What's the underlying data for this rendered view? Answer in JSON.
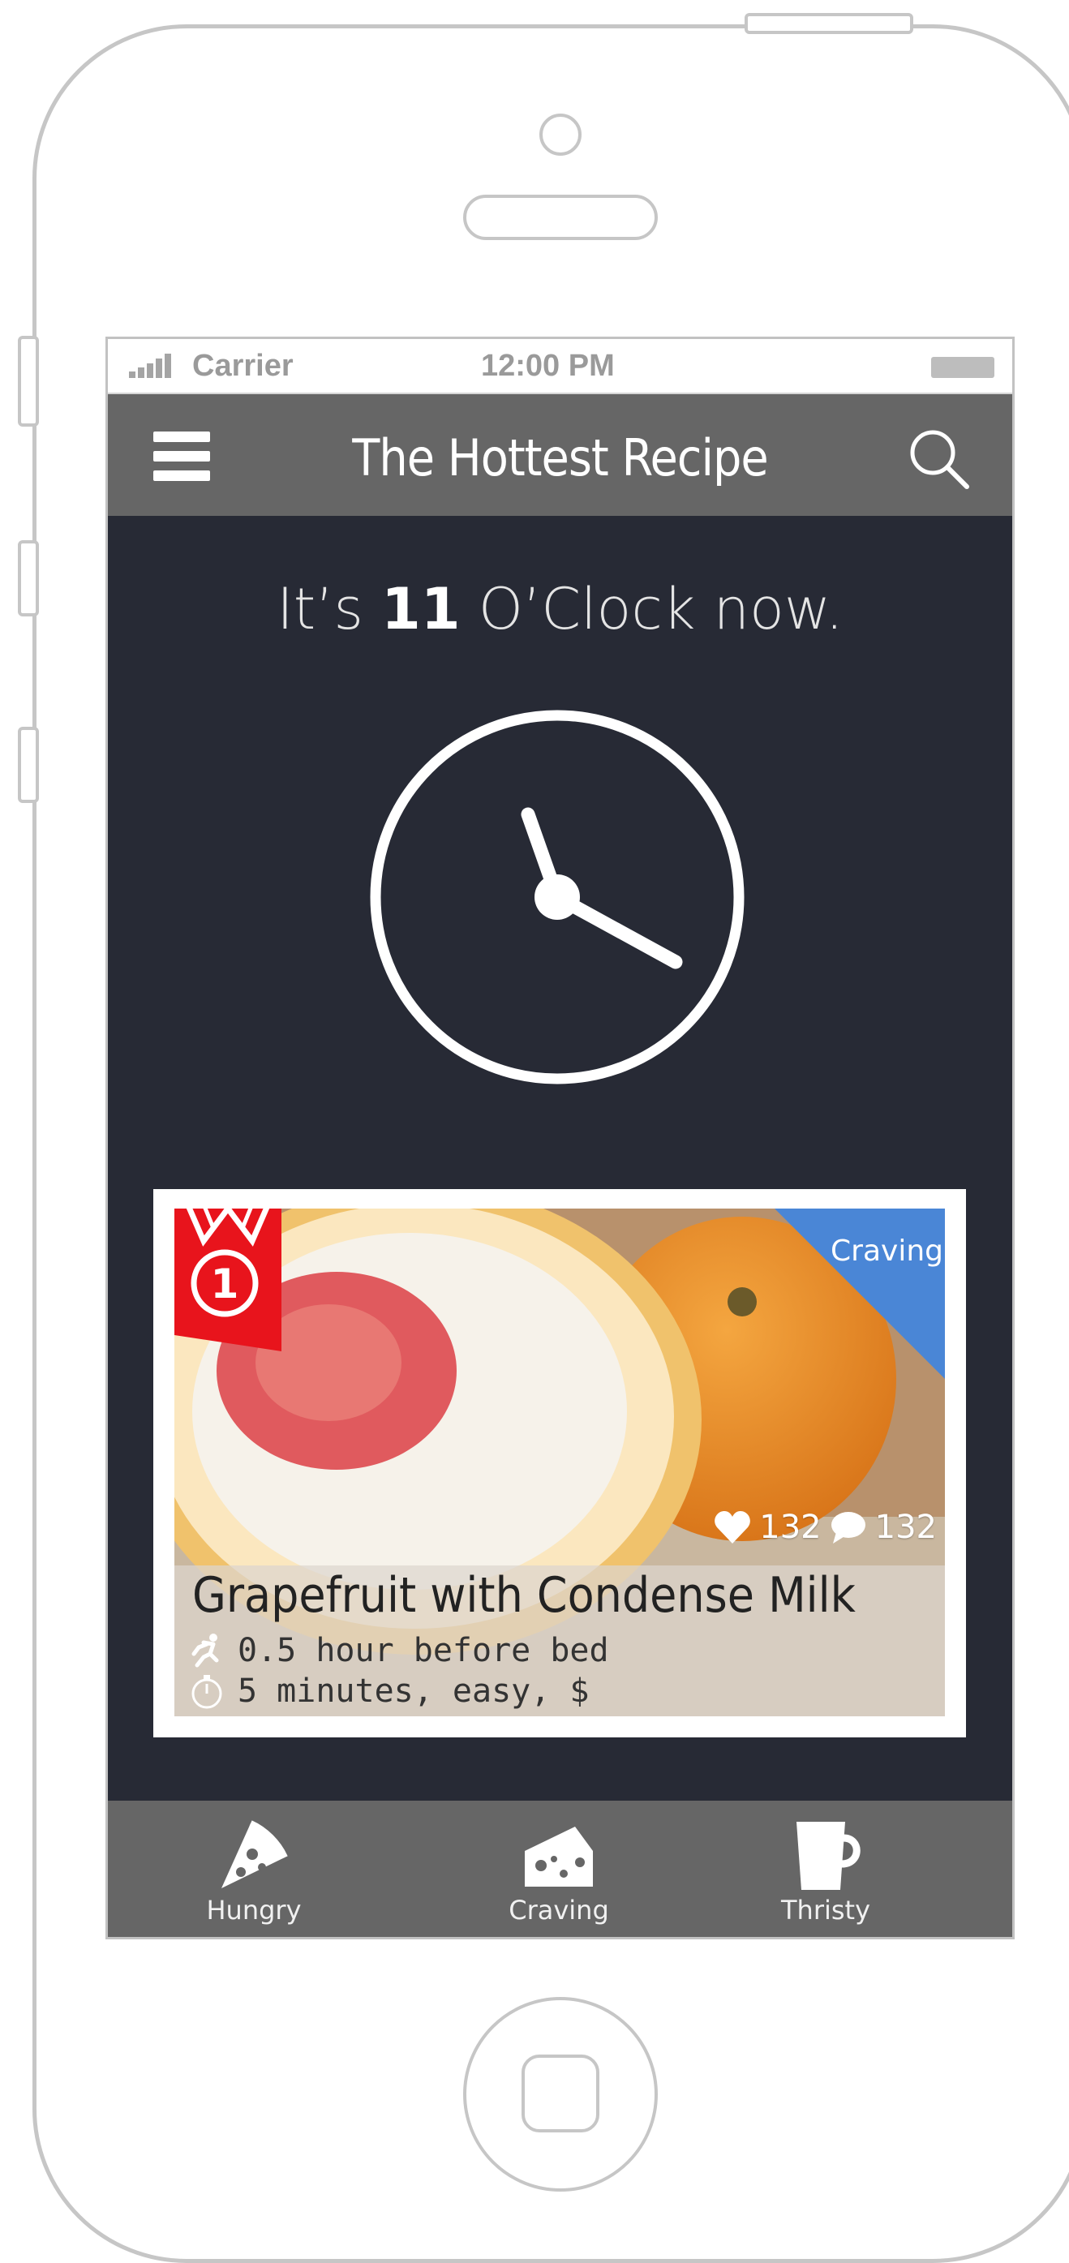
{
  "status_bar": {
    "carrier": "Carrier",
    "time": "12:00 PM"
  },
  "navbar": {
    "title": "The Hottest Recipe",
    "menu_icon": "hamburger-menu-icon",
    "search_icon": "search-icon"
  },
  "hero": {
    "prefix": "It’s ",
    "hour": "11",
    "suffix": " O’Clock now.",
    "icon": "clock-icon"
  },
  "recipe_card": {
    "rank": "1",
    "corner_label": "Craving",
    "likes": "132",
    "comments": "132",
    "title": "Grapefruit with Condense Milk",
    "timing": "0.5 hour before bed",
    "details": "5 minutes, easy, $",
    "accent_color": "#4a86d6",
    "ribbon_color": "#e8141c"
  },
  "tabs": [
    {
      "label": "Hungry",
      "icon": "pizza-slice-icon"
    },
    {
      "label": "Craving",
      "icon": "cheese-icon"
    },
    {
      "label": "Thristy",
      "icon": "cup-icon"
    }
  ]
}
